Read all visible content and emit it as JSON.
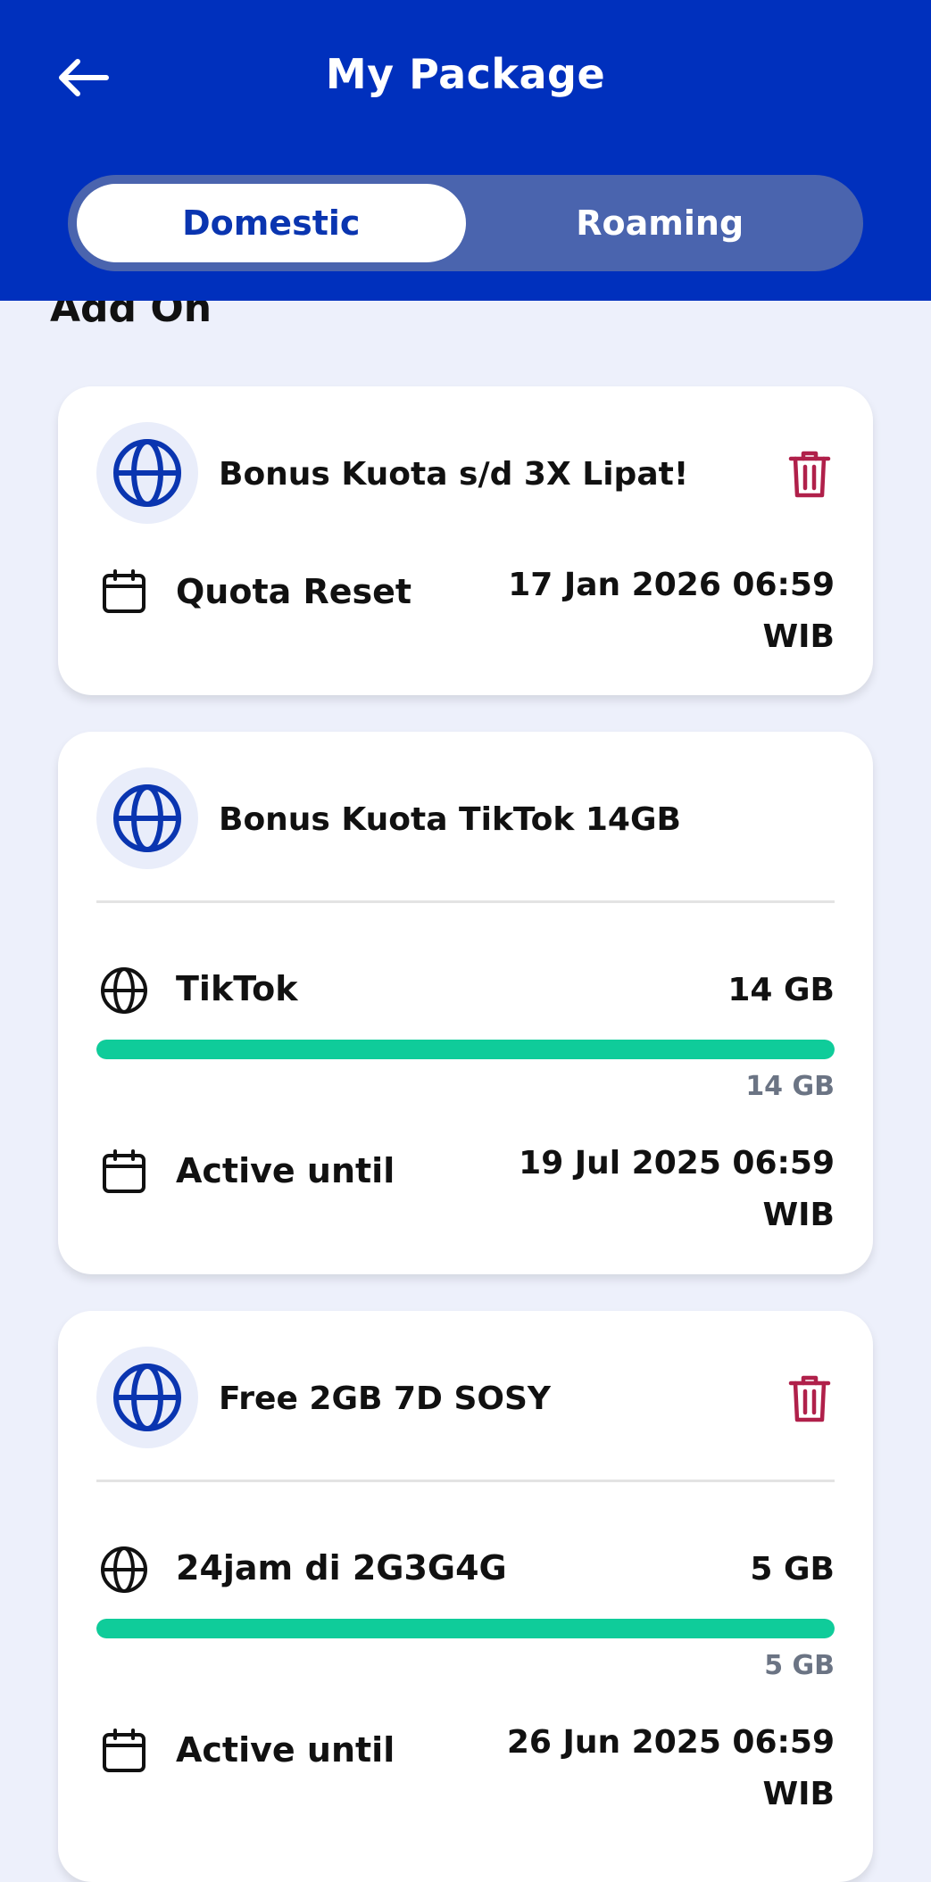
{
  "header": {
    "title": "My Package",
    "back_icon": "arrow-left-icon",
    "tabs": [
      {
        "label": "Domestic",
        "active": true
      },
      {
        "label": "Roaming",
        "active": false
      }
    ]
  },
  "section_title": "Add On",
  "colors": {
    "header": "#0030BD",
    "accent": "#0A35B0",
    "progress": "#0FCC9A",
    "delete": "#B0204A",
    "background": "#EDF0FB"
  },
  "cards": [
    {
      "title": "Bonus Kuota s/d 3X Lipat!",
      "icon": "globe-icon",
      "deletable": true,
      "date_label": "Quota Reset",
      "date_value_line1": "17 Jan 2026 06:59",
      "date_value_line2": "WIB"
    },
    {
      "title": "Bonus Kuota TikTok 14GB",
      "icon": "globe-icon",
      "deletable": false,
      "quota_label": "TikTok",
      "quota_value": "14 GB",
      "quota_remaining": "14 GB",
      "quota_fraction": 1.0,
      "date_label": "Active until",
      "date_value_line1": "19 Jul 2025 06:59",
      "date_value_line2": "WIB"
    },
    {
      "title": "Free 2GB 7D SOSY",
      "icon": "globe-icon",
      "deletable": true,
      "quota_label": "24jam di 2G3G4G",
      "quota_value": "5 GB",
      "quota_remaining": "5 GB",
      "quota_fraction": 1.0,
      "date_label": "Active until",
      "date_value_line1": "26 Jun 2025 06:59",
      "date_value_line2": "WIB"
    }
  ]
}
